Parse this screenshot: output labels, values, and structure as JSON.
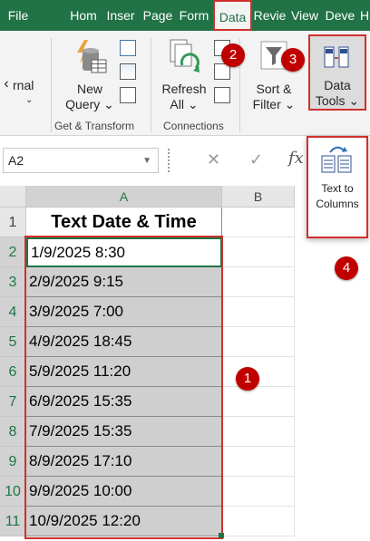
{
  "tabs": [
    "File",
    "Hom",
    "Inser",
    "Page",
    "Form",
    "Data",
    "Revie",
    "View",
    "Deve",
    "H"
  ],
  "ribbon": {
    "prev_group_partial": "rnal",
    "left_arrow": "‹",
    "new_query": [
      "New",
      "Query ⌄"
    ],
    "get_transform_label": "Get & Transform",
    "refresh_all": [
      "Refresh",
      "All ⌄"
    ],
    "connections_label": "Connections",
    "sort_filter": [
      "Sort &",
      "Filter ⌄"
    ],
    "data_tools": [
      "Data",
      "Tools ⌄"
    ]
  },
  "formula_bar": {
    "name_box": "A2",
    "name_box_dropdown": "▼",
    "cancel_icon": "✕",
    "enter_icon": "✓",
    "fx": "fx"
  },
  "popup": {
    "label_line1": "Text to",
    "label_line2": "Columns"
  },
  "sheet": {
    "col_a": "A",
    "col_b": "B",
    "header": "Text Date & Time",
    "rows": [
      "1/9/2025 8:30",
      "2/9/2025 9:15",
      "3/9/2025 7:00",
      "4/9/2025 18:45",
      "5/9/2025 11:20",
      "6/9/2025 15:35",
      "7/9/2025 15:35",
      "8/9/2025 17:10",
      "9/9/2025 10:00",
      "10/9/2025 12:20"
    ],
    "row_numbers": [
      "1",
      "2",
      "3",
      "4",
      "5",
      "6",
      "7",
      "8",
      "9",
      "10",
      "11"
    ]
  },
  "badges": [
    "1",
    "2",
    "3",
    "4"
  ],
  "colors": {
    "excel_green": "#217346",
    "callout_red": "#d0302c",
    "badge_red": "#c00000",
    "selection_gray": "#cfcfcf"
  }
}
